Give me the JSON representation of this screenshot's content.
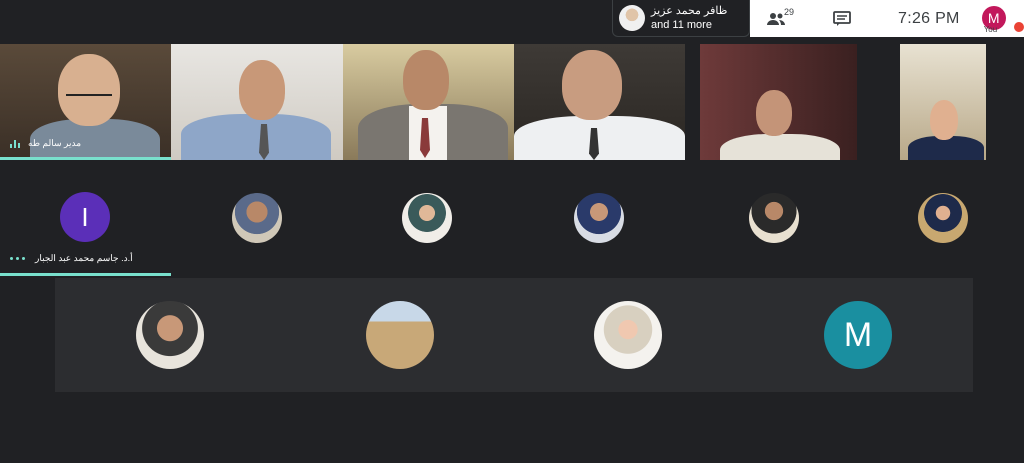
{
  "notification": {
    "name": "ظافر محمد عزيز",
    "more": "and 11 more"
  },
  "topbar": {
    "participant_count": "29",
    "time": "7:26 PM",
    "self_initial": "M",
    "self_label": "You"
  },
  "tiles": {
    "speaker_name": "مدير سالم طه"
  },
  "row2": {
    "presenter_initial": "I",
    "presenter_name": "أ.د. جاسم محمد عبد الجبار"
  },
  "row3": {
    "m_initial": "M"
  },
  "colors": {
    "accent": "#79e0cd",
    "purple": "#5b2fb8",
    "teal": "#1a8fa0",
    "pink": "#c2185b"
  }
}
